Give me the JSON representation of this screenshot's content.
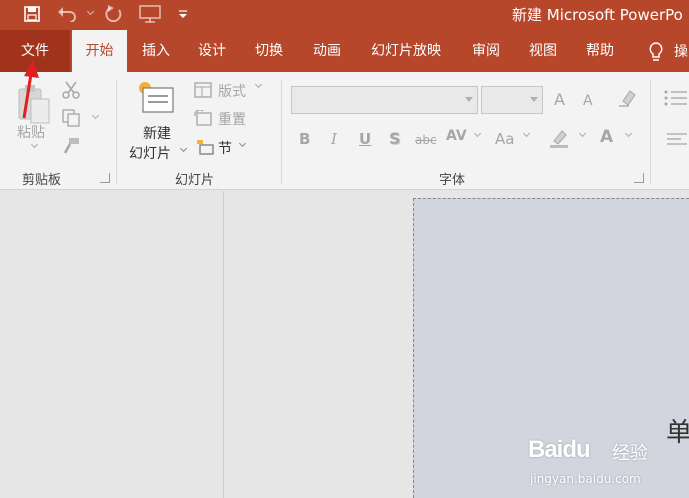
{
  "window": {
    "title": "新建 Microsoft PowerPo"
  },
  "quick_access": [
    "save-icon",
    "undo-icon",
    "redo-icon",
    "present-from-start-icon",
    "customize-qat-icon"
  ],
  "tabs": [
    {
      "label": "文件",
      "active": false
    },
    {
      "label": "开始",
      "active": true
    },
    {
      "label": "插入",
      "active": false
    },
    {
      "label": "设计",
      "active": false
    },
    {
      "label": "切换",
      "active": false
    },
    {
      "label": "动画",
      "active": false
    },
    {
      "label": "幻灯片放映",
      "active": false
    },
    {
      "label": "审阅",
      "active": false
    },
    {
      "label": "视图",
      "active": false
    },
    {
      "label": "帮助",
      "active": false
    }
  ],
  "tell_me": {
    "label": "操"
  },
  "ribbon": {
    "clipboard": {
      "group_label": "剪贴板",
      "paste_label": "粘贴"
    },
    "slides": {
      "group_label": "幻灯片",
      "new_slide_line1": "新建",
      "new_slide_line2": "幻灯片",
      "layout_label": "版式",
      "reset_label": "重置",
      "section_label": "节"
    },
    "font": {
      "group_label": "字体",
      "bold": "B",
      "italic": "I",
      "underline": "U",
      "shadow": "S",
      "strikethrough": "abc",
      "spacing": "AV",
      "change_case": "Aa",
      "font_color": "A",
      "grow": "A",
      "shrink": "A"
    }
  },
  "slide": {
    "visible_text": "单"
  },
  "watermark": {
    "logo": "Baidu",
    "cn": "经验",
    "url": "jingyan.baidu.com"
  },
  "colors": {
    "accent": "#b7472a",
    "file_tab": "#a1331c",
    "ribbon_bg": "#f3f3f3",
    "slide_bg": "#d2d5de",
    "annotation": "#e02020"
  }
}
